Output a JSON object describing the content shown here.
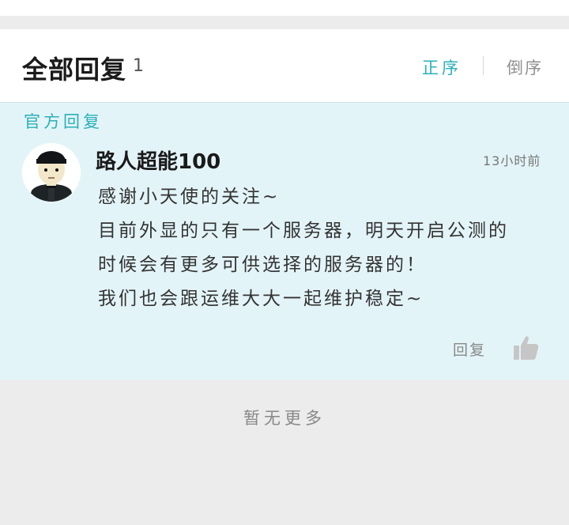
{
  "header": {
    "title": "全部回复",
    "count": "1",
    "sort_asc": "正序",
    "sort_desc": "倒序"
  },
  "official": {
    "label": "官方回复",
    "username": "路人超能100",
    "time": "13小时前",
    "content_lines": [
      "感谢小天使的关注~",
      "目前外显的只有一个服务器，明天开启公测的",
      "时候会有更多可供选择的服务器的！",
      "我们也会跟运维大大一起维护稳定~"
    ],
    "reply_label": "回复",
    "avatar_icon": "avatar-character",
    "like_icon": "thumbs-up-icon"
  },
  "footer": {
    "no_more": "暂无更多"
  },
  "colors": {
    "accent": "#2ab0b8",
    "official_bg": "#e3f4f8",
    "page_bg": "#ececec"
  }
}
